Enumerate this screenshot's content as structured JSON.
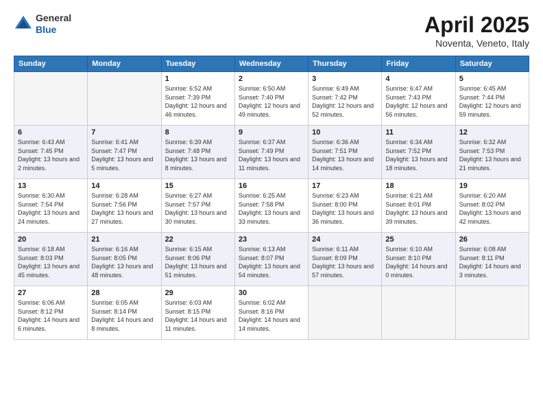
{
  "header": {
    "logo_general": "General",
    "logo_blue": "Blue",
    "title": "April 2025",
    "location": "Noventa, Veneto, Italy"
  },
  "weekdays": [
    "Sunday",
    "Monday",
    "Tuesday",
    "Wednesday",
    "Thursday",
    "Friday",
    "Saturday"
  ],
  "weeks": [
    [
      {
        "day": "",
        "empty": true
      },
      {
        "day": "",
        "empty": true
      },
      {
        "day": "1",
        "sunrise": "Sunrise: 6:52 AM",
        "sunset": "Sunset: 7:39 PM",
        "daylight": "Daylight: 12 hours and 46 minutes."
      },
      {
        "day": "2",
        "sunrise": "Sunrise: 6:50 AM",
        "sunset": "Sunset: 7:40 PM",
        "daylight": "Daylight: 12 hours and 49 minutes."
      },
      {
        "day": "3",
        "sunrise": "Sunrise: 6:49 AM",
        "sunset": "Sunset: 7:42 PM",
        "daylight": "Daylight: 12 hours and 52 minutes."
      },
      {
        "day": "4",
        "sunrise": "Sunrise: 6:47 AM",
        "sunset": "Sunset: 7:43 PM",
        "daylight": "Daylight: 12 hours and 56 minutes."
      },
      {
        "day": "5",
        "sunrise": "Sunrise: 6:45 AM",
        "sunset": "Sunset: 7:44 PM",
        "daylight": "Daylight: 12 hours and 59 minutes."
      }
    ],
    [
      {
        "day": "6",
        "sunrise": "Sunrise: 6:43 AM",
        "sunset": "Sunset: 7:45 PM",
        "daylight": "Daylight: 13 hours and 2 minutes."
      },
      {
        "day": "7",
        "sunrise": "Sunrise: 6:41 AM",
        "sunset": "Sunset: 7:47 PM",
        "daylight": "Daylight: 13 hours and 5 minutes."
      },
      {
        "day": "8",
        "sunrise": "Sunrise: 6:39 AM",
        "sunset": "Sunset: 7:48 PM",
        "daylight": "Daylight: 13 hours and 8 minutes."
      },
      {
        "day": "9",
        "sunrise": "Sunrise: 6:37 AM",
        "sunset": "Sunset: 7:49 PM",
        "daylight": "Daylight: 13 hours and 11 minutes."
      },
      {
        "day": "10",
        "sunrise": "Sunrise: 6:36 AM",
        "sunset": "Sunset: 7:51 PM",
        "daylight": "Daylight: 13 hours and 14 minutes."
      },
      {
        "day": "11",
        "sunrise": "Sunrise: 6:34 AM",
        "sunset": "Sunset: 7:52 PM",
        "daylight": "Daylight: 13 hours and 18 minutes."
      },
      {
        "day": "12",
        "sunrise": "Sunrise: 6:32 AM",
        "sunset": "Sunset: 7:53 PM",
        "daylight": "Daylight: 13 hours and 21 minutes."
      }
    ],
    [
      {
        "day": "13",
        "sunrise": "Sunrise: 6:30 AM",
        "sunset": "Sunset: 7:54 PM",
        "daylight": "Daylight: 13 hours and 24 minutes."
      },
      {
        "day": "14",
        "sunrise": "Sunrise: 6:28 AM",
        "sunset": "Sunset: 7:56 PM",
        "daylight": "Daylight: 13 hours and 27 minutes."
      },
      {
        "day": "15",
        "sunrise": "Sunrise: 6:27 AM",
        "sunset": "Sunset: 7:57 PM",
        "daylight": "Daylight: 13 hours and 30 minutes."
      },
      {
        "day": "16",
        "sunrise": "Sunrise: 6:25 AM",
        "sunset": "Sunset: 7:58 PM",
        "daylight": "Daylight: 13 hours and 33 minutes."
      },
      {
        "day": "17",
        "sunrise": "Sunrise: 6:23 AM",
        "sunset": "Sunset: 8:00 PM",
        "daylight": "Daylight: 13 hours and 36 minutes."
      },
      {
        "day": "18",
        "sunrise": "Sunrise: 6:21 AM",
        "sunset": "Sunset: 8:01 PM",
        "daylight": "Daylight: 13 hours and 39 minutes."
      },
      {
        "day": "19",
        "sunrise": "Sunrise: 6:20 AM",
        "sunset": "Sunset: 8:02 PM",
        "daylight": "Daylight: 13 hours and 42 minutes."
      }
    ],
    [
      {
        "day": "20",
        "sunrise": "Sunrise: 6:18 AM",
        "sunset": "Sunset: 8:03 PM",
        "daylight": "Daylight: 13 hours and 45 minutes."
      },
      {
        "day": "21",
        "sunrise": "Sunrise: 6:16 AM",
        "sunset": "Sunset: 8:05 PM",
        "daylight": "Daylight: 13 hours and 48 minutes."
      },
      {
        "day": "22",
        "sunrise": "Sunrise: 6:15 AM",
        "sunset": "Sunset: 8:06 PM",
        "daylight": "Daylight: 13 hours and 51 minutes."
      },
      {
        "day": "23",
        "sunrise": "Sunrise: 6:13 AM",
        "sunset": "Sunset: 8:07 PM",
        "daylight": "Daylight: 13 hours and 54 minutes."
      },
      {
        "day": "24",
        "sunrise": "Sunrise: 6:11 AM",
        "sunset": "Sunset: 8:09 PM",
        "daylight": "Daylight: 13 hours and 57 minutes."
      },
      {
        "day": "25",
        "sunrise": "Sunrise: 6:10 AM",
        "sunset": "Sunset: 8:10 PM",
        "daylight": "Daylight: 14 hours and 0 minutes."
      },
      {
        "day": "26",
        "sunrise": "Sunrise: 6:08 AM",
        "sunset": "Sunset: 8:11 PM",
        "daylight": "Daylight: 14 hours and 3 minutes."
      }
    ],
    [
      {
        "day": "27",
        "sunrise": "Sunrise: 6:06 AM",
        "sunset": "Sunset: 8:12 PM",
        "daylight": "Daylight: 14 hours and 6 minutes."
      },
      {
        "day": "28",
        "sunrise": "Sunrise: 6:05 AM",
        "sunset": "Sunset: 8:14 PM",
        "daylight": "Daylight: 14 hours and 8 minutes."
      },
      {
        "day": "29",
        "sunrise": "Sunrise: 6:03 AM",
        "sunset": "Sunset: 8:15 PM",
        "daylight": "Daylight: 14 hours and 11 minutes."
      },
      {
        "day": "30",
        "sunrise": "Sunrise: 6:02 AM",
        "sunset": "Sunset: 8:16 PM",
        "daylight": "Daylight: 14 hours and 14 minutes."
      },
      {
        "day": "",
        "empty": true
      },
      {
        "day": "",
        "empty": true
      },
      {
        "day": "",
        "empty": true
      }
    ]
  ]
}
